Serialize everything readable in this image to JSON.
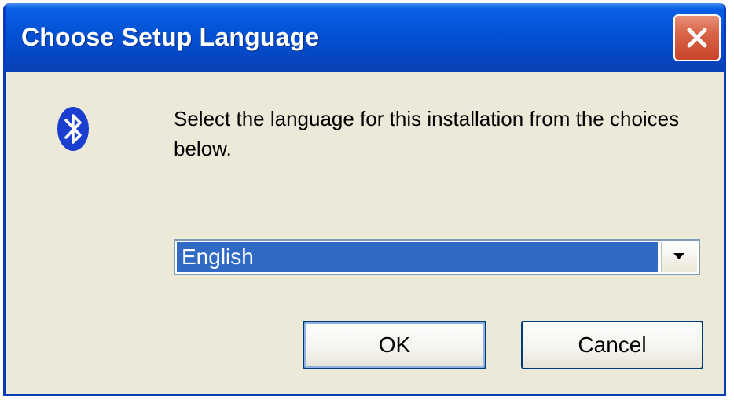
{
  "window": {
    "title": "Choose Setup Language"
  },
  "icons": {
    "app_icon": "bluetooth-icon",
    "close_icon": "close-icon",
    "dropdown_icon": "chevron-down-icon"
  },
  "dialog": {
    "message": "Select the language for this installation from the choices below."
  },
  "language_select": {
    "selected": "English"
  },
  "buttons": {
    "ok_label": "OK",
    "cancel_label": "Cancel"
  },
  "colors": {
    "titlebar": "#0453d6",
    "window_bg": "#ece9d8",
    "selection": "#316ac5",
    "close_button": "#d96448",
    "bluetooth": "#1a3fcf"
  }
}
